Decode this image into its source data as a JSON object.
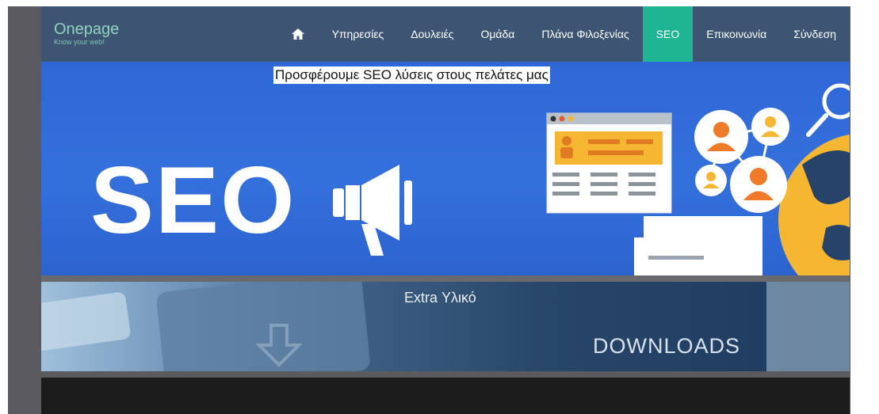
{
  "brand": {
    "title": "Onepage",
    "tagline": "Know your web!"
  },
  "nav": {
    "home_icon": "home-icon",
    "items": [
      {
        "label": "Υπηρεσίες",
        "active": false
      },
      {
        "label": "Δουλειές",
        "active": false
      },
      {
        "label": "Ομάδα",
        "active": false
      },
      {
        "label": "Πλάνα Φιλοξενίας",
        "active": false
      },
      {
        "label": "SEO",
        "active": true
      },
      {
        "label": "Επικοινωνία",
        "active": false
      },
      {
        "label": "Σύνδεση",
        "active": false
      }
    ]
  },
  "hero": {
    "caption": "Προσφέρουμε SEO λύσεις στους πελάτες μας",
    "image_text": "SEO",
    "icons": [
      "megaphone-icon",
      "browser-window-icon",
      "user-network-icon",
      "magnifier-icon",
      "globe-icon"
    ]
  },
  "downloads": {
    "title": "Extra Υλικό",
    "label": "DOWNLOADS",
    "icon": "download-arrow-icon"
  },
  "colors": {
    "navbar": "#3d5572",
    "active": "#1fb492",
    "brand": "#8fd3c0",
    "hero": "#3470dc"
  }
}
